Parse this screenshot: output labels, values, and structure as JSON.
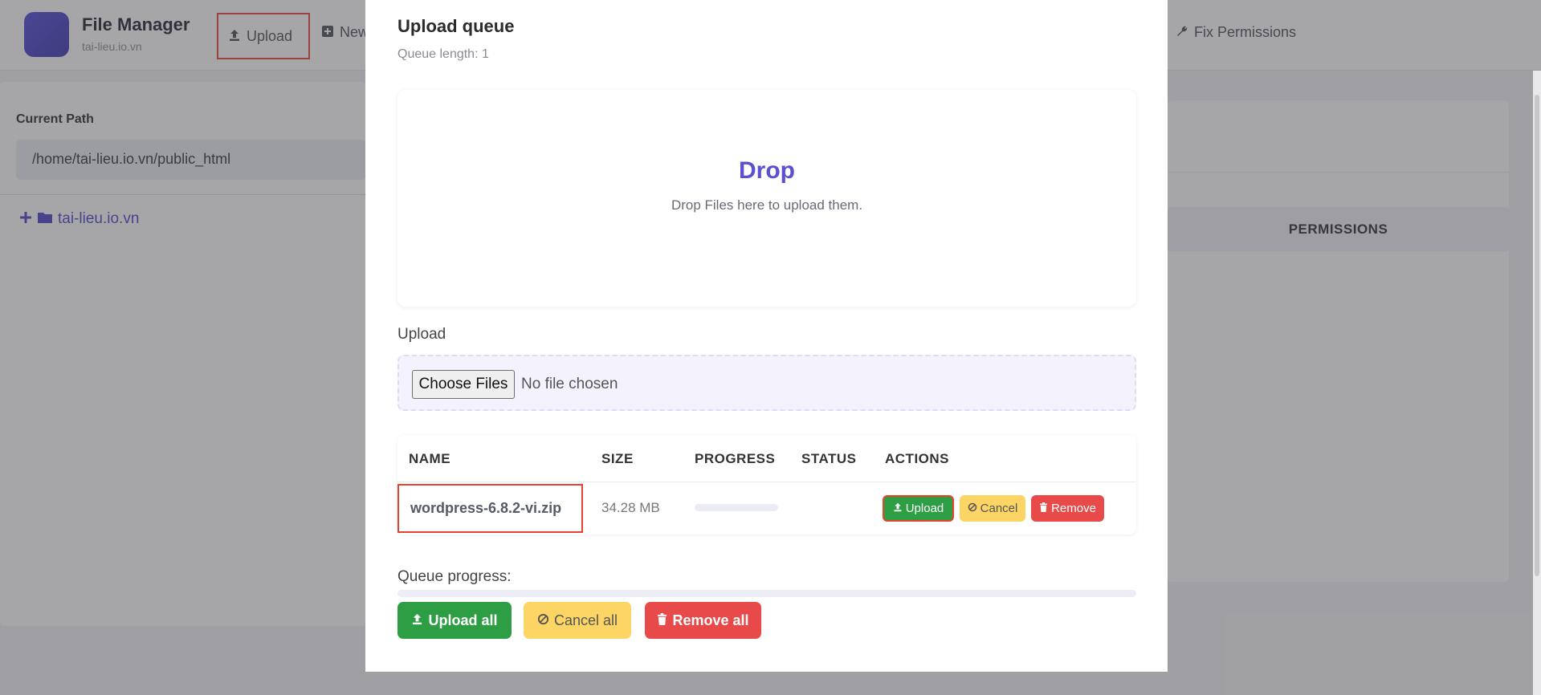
{
  "app": {
    "title": "File Manager",
    "subtitle": "tai-lieu.io.vn",
    "nav": {
      "upload_label": "Upload",
      "new_label": "New",
      "fix_permissions_label": "Fix Permissions"
    },
    "current_path_label": "Current Path",
    "current_path_value": "/home/tai-lieu.io.vn/public_html",
    "tree_root": "tai-lieu.io.vn",
    "permissions_header": "PERMISSIONS"
  },
  "modal": {
    "title": "Upload queue",
    "queue_length": "Queue length: 1",
    "dropzone": {
      "title": "Drop",
      "subtitle": "Drop Files here to upload them."
    },
    "upload_label": "Upload",
    "file_input": {
      "button": "Choose Files",
      "status": "No file chosen"
    },
    "table": {
      "headers": [
        "NAME",
        "SIZE",
        "PROGRESS",
        "STATUS",
        "ACTIONS"
      ],
      "rows": [
        {
          "name": "wordpress-6.8.2-vi.zip",
          "size": "34.28 MB",
          "progress": 0,
          "status": "",
          "actions": {
            "upload": "Upload",
            "cancel": "Cancel",
            "remove": "Remove"
          }
        }
      ]
    },
    "queue_progress_label": "Queue progress:",
    "queue_progress": 0,
    "buttons": {
      "upload_all": "Upload all",
      "cancel_all": "Cancel all",
      "remove_all": "Remove all"
    }
  },
  "colors": {
    "accent": "#5a50d0",
    "success": "#2e9e45",
    "warning": "#fcd564",
    "danger": "#e84a4a",
    "highlight": "#e5432b"
  },
  "icons": {
    "upload": "upload-icon",
    "new": "plus-square-icon",
    "fix_permissions": "wrench-icon",
    "tree_expand": "plus-icon",
    "folder": "folder-icon",
    "cancel": "ban-icon",
    "remove": "trash-icon"
  }
}
